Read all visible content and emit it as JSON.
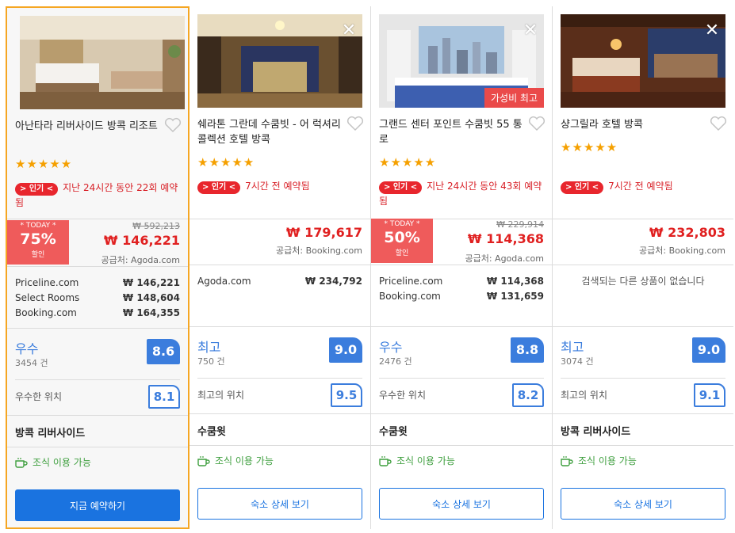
{
  "cards": [
    {
      "name": "아난타라 리버사이드 방콕 리조트",
      "stars": "★★★★★",
      "popular_pill": "> 인기 <",
      "popular_text": "지난 24시간 동안 22회 예약됨",
      "deal_top": "* TODAY *",
      "deal_pct": "75%",
      "deal_sub": "할인",
      "old_price": "₩ 592,213",
      "price": "₩ 146,221",
      "supplier": "공급처: Agoda.com",
      "others": [
        {
          "site": "Priceline.com",
          "price": "₩ 146,221"
        },
        {
          "site": "Select Rooms",
          "price": "₩ 148,604"
        },
        {
          "site": "Booking.com",
          "price": "₩ 164,355"
        }
      ],
      "review_word": "우수",
      "review_count": "3454 건",
      "score": "8.6",
      "loc_label": "우수한 위치",
      "loc_score": "8.1",
      "area": "방콕 리버사이드",
      "breakfast": "조식 이용 가능",
      "button": "지금 예약하기"
    },
    {
      "name": "쉐라톤 그란데 수쿰빗 - 어 럭셔리 콜렉션 호텔 방콕",
      "stars": "★★★★★",
      "popular_pill": "> 인기 <",
      "popular_text": "7시간 전 예약됨",
      "price": "₩ 179,617",
      "supplier": "공급처: Booking.com",
      "others": [
        {
          "site": "Agoda.com",
          "price": "₩ 234,792"
        }
      ],
      "review_word": "최고",
      "review_count": "750 건",
      "score": "9.0",
      "loc_label": "최고의 위치",
      "loc_score": "9.5",
      "area": "수쿰윗",
      "breakfast": "조식 이용 가능",
      "button": "숙소 상세 보기"
    },
    {
      "name": "그랜드 센터 포인트 수쿰빗 55 통로",
      "stars": "★★★★★",
      "best_value": "가성비 최고",
      "popular_pill": "> 인기 <",
      "popular_text": "지난 24시간 동안 43회 예약됨",
      "deal_top": "* TODAY *",
      "deal_pct": "50%",
      "deal_sub": "할인",
      "old_price": "₩ 229,914",
      "price": "₩ 114,368",
      "supplier": "공급처: Agoda.com",
      "others": [
        {
          "site": "Priceline.com",
          "price": "₩ 114,368"
        },
        {
          "site": "Booking.com",
          "price": "₩ 131,659"
        }
      ],
      "review_word": "우수",
      "review_count": "2476 건",
      "score": "8.8",
      "loc_label": "우수한 위치",
      "loc_score": "8.2",
      "area": "수쿰윗",
      "breakfast": "조식 이용 가능",
      "button": "숙소 상세 보기"
    },
    {
      "name": "샹그릴라 호텔 방콕",
      "stars": "★★★★★",
      "popular_pill": "> 인기 <",
      "popular_text": "7시간 전 예약됨",
      "price": "₩ 232,803",
      "supplier": "공급처: Booking.com",
      "none_msg": "검색되는 다른 상품이 없습니다",
      "review_word": "최고",
      "review_count": "3074 건",
      "score": "9.0",
      "loc_label": "최고의 위치",
      "loc_score": "9.1",
      "area": "방콕 리버사이드",
      "breakfast": "조식 이용 가능",
      "button": "숙소 상세 보기"
    }
  ],
  "close_glyph": "✕",
  "colors": {
    "accent": "#1a73e0",
    "score": "#3b7ddd",
    "price": "#e02020",
    "deal": "#ef5b5b",
    "selected_border": "#f5a623"
  }
}
